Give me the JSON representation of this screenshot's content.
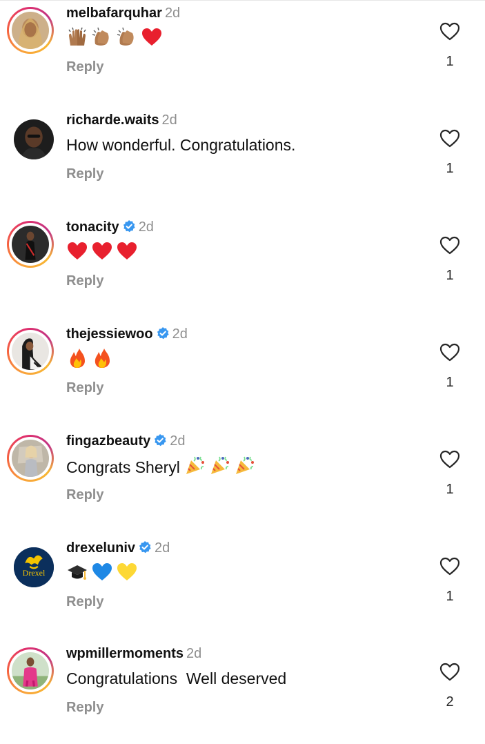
{
  "comments": [
    {
      "username": "melbafarquhar",
      "time": "2d",
      "verified": false,
      "text": "",
      "emojis": [
        "raising-hands-emoji",
        "clapping-hands-emoji",
        "clapping-hands-emoji",
        "red-heart-emoji"
      ],
      "reply_label": "Reply",
      "likes": "1"
    },
    {
      "username": "richarde.waits",
      "time": "2d",
      "verified": false,
      "text": "How wonderful. Congratulations.",
      "emojis": [],
      "reply_label": "Reply",
      "likes": "1"
    },
    {
      "username": "tonacity",
      "time": "2d",
      "verified": true,
      "text": "",
      "emojis": [
        "red-heart-emoji",
        "red-heart-emoji",
        "red-heart-emoji"
      ],
      "reply_label": "Reply",
      "likes": "1"
    },
    {
      "username": "thejessiewoo",
      "time": "2d",
      "verified": true,
      "text": "",
      "emojis": [
        "fire-emoji",
        "fire-emoji"
      ],
      "reply_label": "Reply",
      "likes": "1"
    },
    {
      "username": "fingazbeauty",
      "time": "2d",
      "verified": true,
      "text": "Congrats Sheryl",
      "emojis": [
        "party-popper-emoji",
        "party-popper-emoji",
        "party-popper-emoji"
      ],
      "reply_label": "Reply",
      "likes": "1"
    },
    {
      "username": "drexeluniv",
      "time": "2d",
      "verified": true,
      "text": "",
      "emojis": [
        "graduation-cap-emoji",
        "blue-heart-emoji",
        "yellow-heart-emoji"
      ],
      "reply_label": "Reply",
      "likes": "1",
      "avatar_text": "Drexel"
    },
    {
      "username": "wpmillermoments",
      "time": "2d",
      "verified": false,
      "text": "Congratulations  Well deserved",
      "emojis": [],
      "reply_label": "Reply",
      "likes": "2"
    }
  ],
  "colors": {
    "verified_blue": "#3897f0",
    "secondary_text": "#8e8e8e",
    "primary_text": "#111111",
    "heart_red": "#e8202e"
  }
}
